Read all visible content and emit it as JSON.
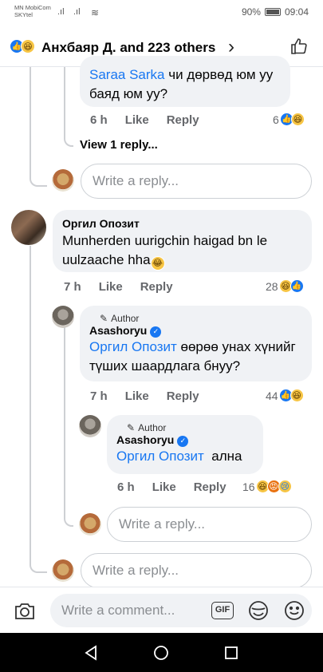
{
  "status_bar": {
    "carrier_1": "MN MobiCom",
    "carrier_2": "SKYtel",
    "battery": "90%",
    "time": "09:04"
  },
  "header": {
    "title": "Анхбаяр Д. and 223 others"
  },
  "comments": {
    "saraa": {
      "tag": "Saraa Sarka",
      "text": " чи дөрвөд юм уу баяд юм уу?",
      "time": "6 h",
      "like": "Like",
      "reply": "Reply",
      "reactions": "6"
    },
    "view_replies": "View 1 reply...",
    "orgil": {
      "name": "Оргил Опозит",
      "text": "Munherden uurigchin haigad bn le uulzaache hha",
      "time": "7 h",
      "like": "Like",
      "reply": "Reply",
      "reactions": "28"
    },
    "asashoryu_1": {
      "badge": "Author",
      "name": "Asashoryu",
      "tag": "Оргил Опозит",
      "text": " өөрөө унах хүнийг түших шаардлага бнуу?",
      "time": "7 h",
      "like": "Like",
      "reply": "Reply",
      "reactions": "44"
    },
    "asashoryu_2": {
      "badge": "Author",
      "name": "Asashoryu",
      "tag": "Оргил Опозит",
      "text": "  ална",
      "time": "6 h",
      "like": "Like",
      "reply": "Reply",
      "reactions": "16"
    }
  },
  "reply_placeholder": "Write a reply...",
  "comment_placeholder": "Write a comment...",
  "gif_label": "GIF"
}
